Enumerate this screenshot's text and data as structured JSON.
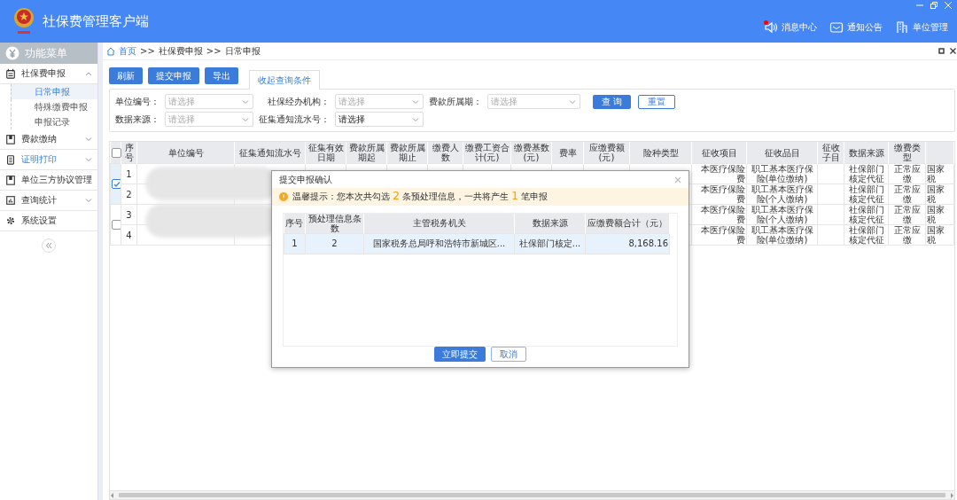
{
  "app": {
    "title": "社保费管理客户端"
  },
  "header_links": [
    {
      "label": "消息中心",
      "unread": true
    },
    {
      "label": "通知公告",
      "unread": false
    },
    {
      "label": "单位管理",
      "unread": false
    }
  ],
  "sidebar": {
    "title": "功能菜单",
    "items": [
      {
        "label": "社保费申报",
        "kind": "group",
        "expanded": true,
        "selected": false,
        "children": [
          {
            "label": "日常申报",
            "selected": true
          },
          {
            "label": "特殊缴费申报",
            "selected": false
          },
          {
            "label": "申报记录",
            "selected": false
          }
        ]
      },
      {
        "label": "费款缴纳",
        "kind": "group",
        "expanded": false,
        "selected": false
      },
      {
        "label": "证明打印",
        "kind": "group",
        "expanded": false,
        "selected": true
      },
      {
        "label": "单位三方协议管理",
        "kind": "link",
        "selected": false
      },
      {
        "label": "查询统计",
        "kind": "group",
        "expanded": false,
        "selected": false
      },
      {
        "label": "系统设置",
        "kind": "link",
        "selected": false
      }
    ]
  },
  "breadcrumb": {
    "separator": ">>",
    "items": [
      "首页",
      "社保费申报",
      "日常申报"
    ]
  },
  "toolbar": [
    "刷新",
    "提交申报",
    "导出"
  ],
  "query_tab": {
    "label": "收起查询条件"
  },
  "filters": [
    {
      "label": "单位编号：",
      "placeholder": "请选择"
    },
    {
      "label": "社保经办机构：",
      "placeholder": "请选择"
    },
    {
      "label": "费款所属期：",
      "placeholder": "请选择"
    },
    {
      "label": "数据来源：",
      "placeholder": "请选择"
    },
    {
      "label": "征集通知流水号：",
      "value": "请选择"
    }
  ],
  "filter_buttons": [
    {
      "label": "查 询",
      "kind": "primary"
    },
    {
      "label": "重置",
      "kind": "outline"
    }
  ],
  "table": {
    "all_checked": false,
    "columns": [
      "序号",
      "单位编号",
      "征集通知流水号",
      "征集有效日期",
      "费款所属期起",
      "费款所属期止",
      "缴费人数",
      "缴费工资合计(元)",
      "缴费基数(元)",
      "费率",
      "应缴费额(元)",
      "险种类型",
      "征收项目",
      "征收品目",
      "征收子目",
      "数据来源",
      "缴费类型"
    ],
    "groups": [
      {
        "selected": true,
        "rows": [
          {
            "number": "1",
            "item": "本医疗保险费",
            "category": "职工基本医疗保险(单位缴纳)",
            "source": "社保部门核定代征",
            "pay_type": "正常应缴",
            "column_18": "国家税"
          },
          {
            "number": "2",
            "item": "本医疗保险费",
            "category": "职工基本医疗保险(个人缴纳)",
            "source": "社保部门核定代征",
            "pay_type": "正常应缴",
            "column_18": "国家税"
          }
        ]
      },
      {
        "selected": false,
        "rows": [
          {
            "number": "3",
            "item": "本医疗保险费",
            "category": "职工基本医疗保险(个人缴纳)",
            "source": "社保部门核定代征",
            "pay_type": "正常应缴",
            "column_18": "国家税"
          },
          {
            "number": "4",
            "item": "本医疗保险费",
            "category": "职工基本医疗保险(单位缴纳)",
            "source": "社保部门核定代征",
            "pay_type": "正常应缴",
            "column_18": "国家税"
          }
        ]
      }
    ]
  },
  "dialog": {
    "title": "提交申报确认",
    "notice": [
      {
        "kind": "text",
        "text": "温馨提示：您本次共勾选 "
      },
      {
        "kind": "number",
        "text": "2"
      },
      {
        "kind": "text",
        "text": " 条预处理信息，一共将产生 "
      },
      {
        "kind": "number",
        "text": "1"
      },
      {
        "kind": "text",
        "text": " 笔申报"
      }
    ],
    "columns": [
      "序号",
      "预处理信息条数",
      "主管税务机关",
      "数据来源",
      "应缴费额合计（元）"
    ],
    "rows": [
      [
        "1",
        "2",
        "国家税务总局呼和浩特市新城区...",
        "社保部门核定...",
        "8,168.16"
      ]
    ],
    "buttons": [
      {
        "label": "立即提交",
        "kind": "primary"
      },
      {
        "label": "取消",
        "kind": "outline"
      }
    ]
  }
}
